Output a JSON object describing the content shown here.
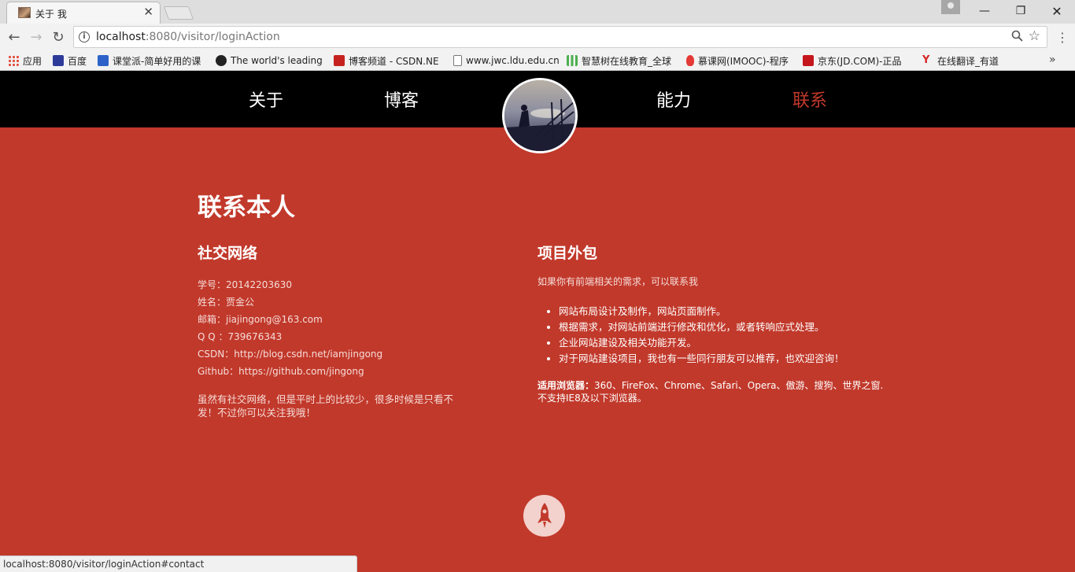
{
  "browser": {
    "tab_title": "关于 我",
    "url_host": "localhost",
    "url_path": ":8080/visitor/loginAction",
    "bookmarks": [
      {
        "label": "应用",
        "color": "#e34b3a"
      },
      {
        "label": "百度",
        "color": "#2e3a9a"
      },
      {
        "label": "课堂派-简单好用的课",
        "color": "#2d63c8"
      },
      {
        "label": "The world's leading",
        "color": "#222222"
      },
      {
        "label": "博客频道 - CSDN.NE",
        "color": "#c5221f"
      },
      {
        "label": "www.jwc.ldu.edu.cn",
        "color": "#ffffff"
      },
      {
        "label": "智慧树在线教育_全球",
        "color": "#4caf50"
      },
      {
        "label": "慕课网(IMOOC)-程序",
        "color": "#e53935"
      },
      {
        "label": "京东(JD.COM)-正品",
        "color": "#c4161c"
      },
      {
        "label": "在线翻译_有道",
        "color": "#d62828"
      }
    ],
    "status_text": "localhost:8080/visitor/loginAction#contact"
  },
  "nav": {
    "items": [
      {
        "label": "关于"
      },
      {
        "label": "博客"
      },
      {
        "label": "能力"
      },
      {
        "label": "联系"
      }
    ],
    "active_color": "#c1392b"
  },
  "contact": {
    "title": "联系本人",
    "social": {
      "heading": "社交网络",
      "lines": [
        "学号：20142203630",
        "姓名：贾金公",
        "邮箱：jiajingong@163.com",
        "Q Q ：739676343",
        "CSDN：http://blog.csdn.net/iamjingong",
        "Github：https://github.com/jingong"
      ],
      "note": "虽然有社交网络，但是平时上的比较少，很多时候是只看不发！不过你可以关注我哦！"
    },
    "project": {
      "heading": "项目外包",
      "intro": "如果你有前端相关的需求，可以联系我",
      "items": [
        "网站布局设计及制作，网站页面制作。",
        "根据需求，对网站前端进行修改和优化，或者转响应式处理。",
        "企业网站建设及相关功能开发。",
        "对于网站建设项目，我也有一些同行朋友可以推荐，也欢迎咨询！"
      ],
      "browsers_label": "适用浏览器：",
      "browsers_text": "360、FireFox、Chrome、Safari、Opera、傲游、搜狗、世界之窗. 不支持IE8及以下浏览器。"
    }
  },
  "theme": {
    "brand_red": "#c1392b",
    "header_bg": "#000000"
  }
}
